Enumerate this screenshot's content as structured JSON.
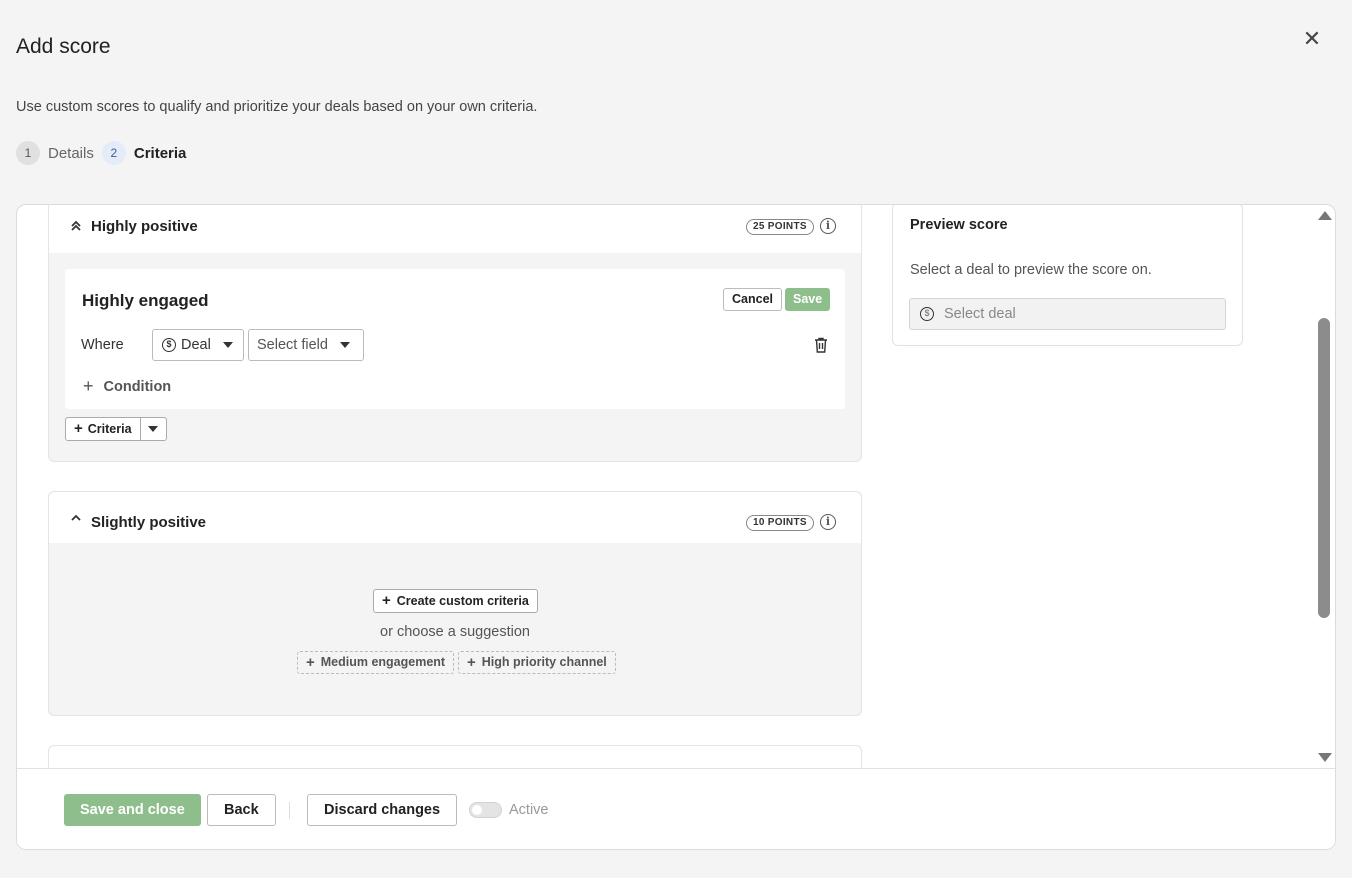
{
  "dialog": {
    "title": "Add score",
    "subtitle": "Use custom scores to qualify and prioritize your deals based on your own criteria.",
    "close_icon": "close-icon"
  },
  "steps": [
    {
      "num": "1",
      "label": "Details",
      "state": "done"
    },
    {
      "num": "2",
      "label": "Criteria",
      "state": "current"
    }
  ],
  "sections": {
    "highly_positive": {
      "title": "Highly positive",
      "points": "25 POINTS",
      "expanded": true,
      "criteria": {
        "name": "Highly engaged",
        "cancel_label": "Cancel",
        "save_label": "Save",
        "where_label": "Where",
        "object_select": "Deal",
        "field_select_placeholder": "Select field",
        "add_condition_label": "Condition"
      },
      "add_criteria_label": "Criteria"
    },
    "slightly_positive": {
      "title": "Slightly positive",
      "points": "10 POINTS",
      "expanded": true,
      "create_custom_label": "Create custom criteria",
      "or_text": "or choose a suggestion",
      "suggestions": [
        "Medium engagement",
        "High priority channel"
      ]
    }
  },
  "preview": {
    "title": "Preview score",
    "subtitle": "Select a deal to preview the score on.",
    "select_placeholder": "Select deal"
  },
  "footer": {
    "save_close_label": "Save and close",
    "back_label": "Back",
    "discard_label": "Discard changes",
    "active_label": "Active",
    "active_on": false
  },
  "colors": {
    "primary_green": "#8ebe8c",
    "background": "#f4f4f4"
  }
}
